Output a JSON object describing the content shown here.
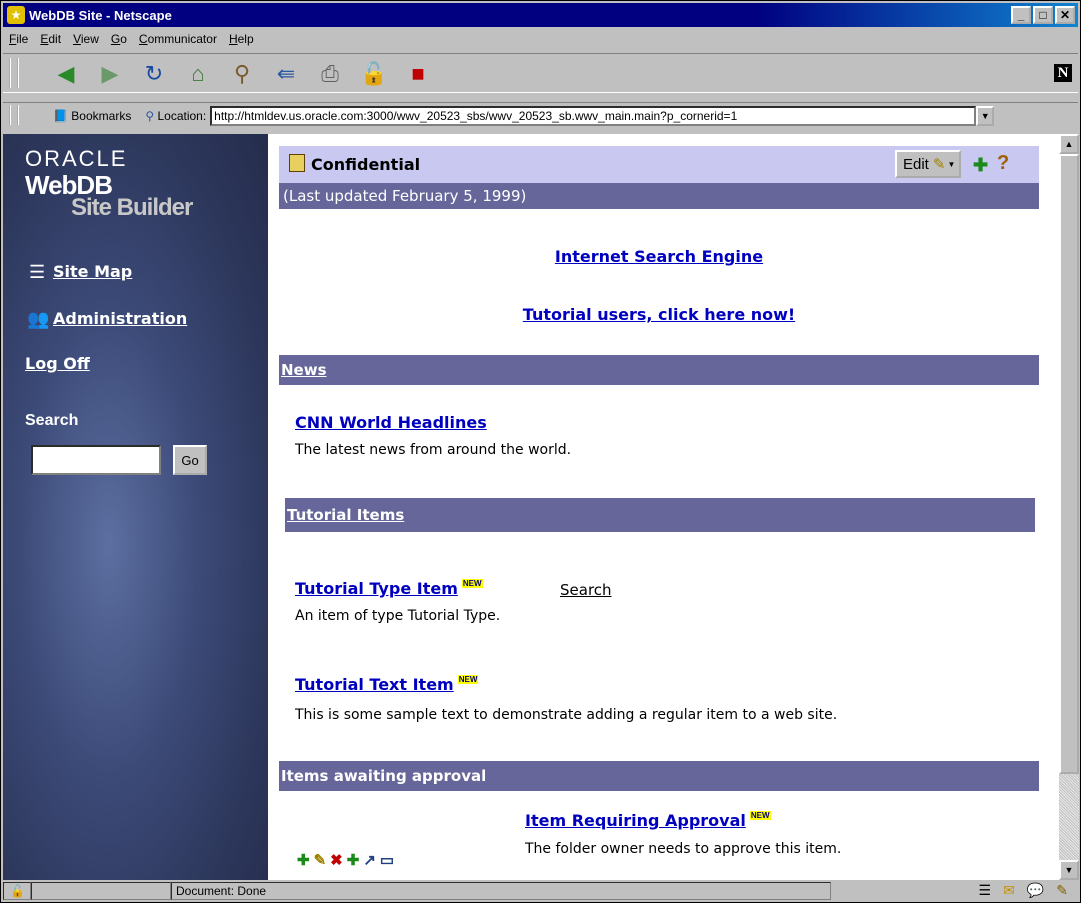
{
  "window": {
    "title": "WebDB Site - Netscape"
  },
  "menu": [
    "File",
    "Edit",
    "View",
    "Go",
    "Communicator",
    "Help"
  ],
  "location": {
    "bookmarks_label": "Bookmarks",
    "location_label": "Location:",
    "url": "http://htmldev.us.oracle.com:3000/wwv_20523_sbs/wwv_20523_sb.wwv_main.main?p_cornerid=1"
  },
  "sidebar": {
    "brand_oracle": "ORACLE",
    "brand_webdb": "WebDB",
    "brand_sitebuilder": "Site Builder",
    "site_map": "Site Map",
    "administration": "Administration",
    "log_off": "Log Off",
    "search_label": "Search",
    "search_value": "",
    "go_label": "Go"
  },
  "main": {
    "folder_title": "Confidential",
    "last_updated": "(Last updated February 5, 1999)",
    "edit_label": "Edit",
    "link_search_engine": "Internet Search Engine",
    "link_tutorial_users": "Tutorial users, click here now!",
    "news": {
      "heading": "News",
      "item_title": "CNN World Headlines",
      "item_desc": "The latest news from around the world."
    },
    "tutorial": {
      "heading": "Tutorial Items",
      "type_item_title": "Tutorial Type Item",
      "type_item_search": "Search",
      "type_item_desc": "An item of type Tutorial Type.",
      "text_item_title": "Tutorial Text Item",
      "text_item_desc": "This is some sample text to demonstrate adding a regular item to a web site."
    },
    "approval": {
      "heading": "Items awaiting approval",
      "item_title": "Item Requiring Approval",
      "item_desc": "The folder owner needs to approve this item."
    },
    "new_badge": "NEW"
  },
  "status": {
    "text": "Document: Done"
  }
}
